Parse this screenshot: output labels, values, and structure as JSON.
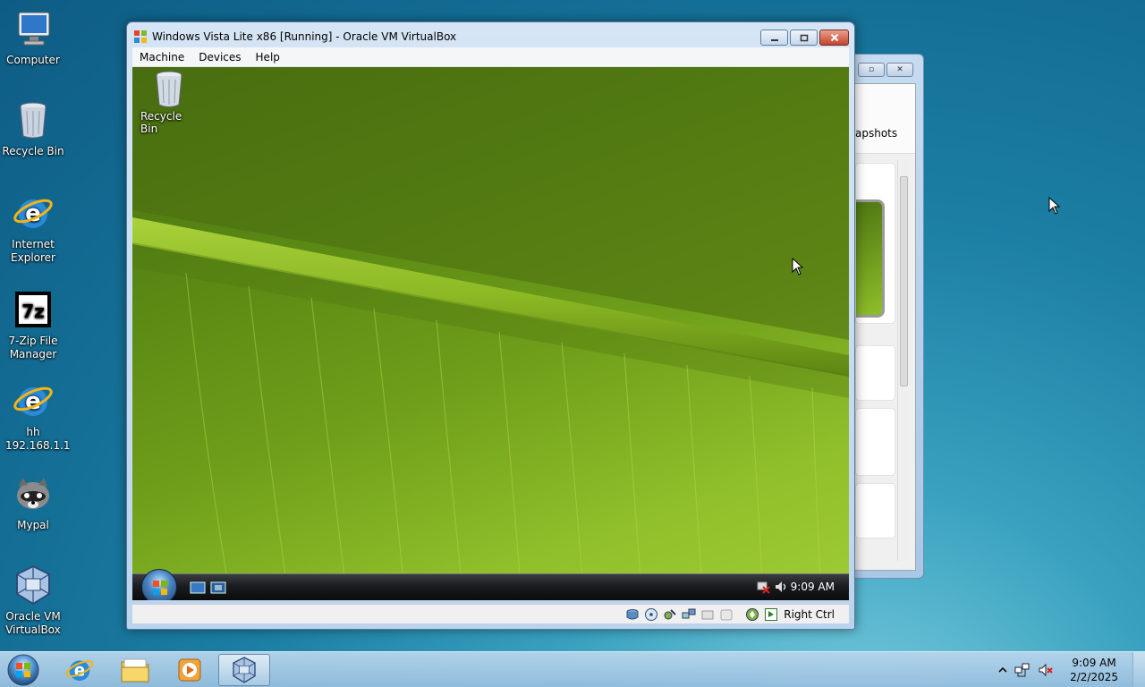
{
  "desktop": {
    "icons": [
      {
        "label": "Computer"
      },
      {
        "label": "Recycle Bin"
      },
      {
        "label": "Internet Explorer"
      },
      {
        "label": "7-Zip File Manager"
      },
      {
        "label": "hh 192.168.1.1"
      },
      {
        "label": "Mypal"
      },
      {
        "label": "Oracle VM VirtualBox"
      }
    ]
  },
  "background_window": {
    "toolbar_text": "apshots"
  },
  "vm_window": {
    "title": "Windows Vista Lite x86 [Running] - Oracle VM VirtualBox",
    "menu": [
      "Machine",
      "Devices",
      "Help"
    ],
    "status_label": "Right Ctrl",
    "guest": {
      "desktop_icon": "Recycle Bin",
      "clock": "9:09 AM"
    }
  },
  "taskbar": {
    "time": "9:09 AM",
    "date": "2/2/2025"
  },
  "colors": {
    "host_accent": "#1c7fa4",
    "guest_wallpaper": "#6f9e1a",
    "close_button": "#c5432c"
  }
}
